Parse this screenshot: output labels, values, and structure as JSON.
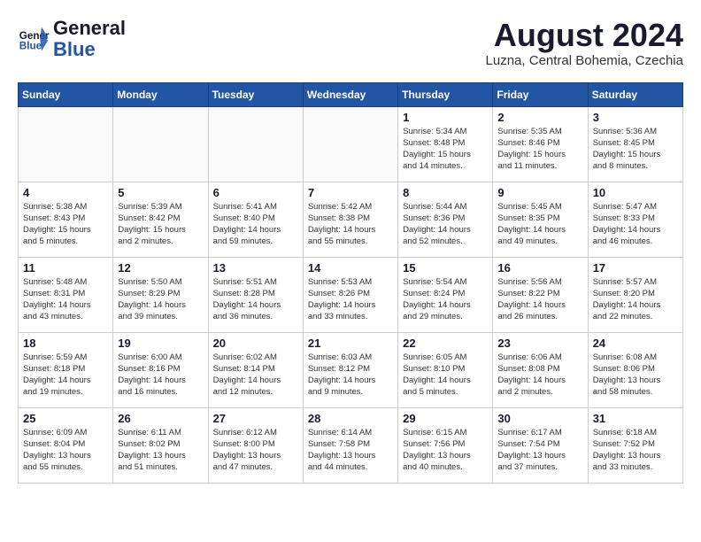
{
  "header": {
    "logo_general": "General",
    "logo_blue": "Blue",
    "month_year": "August 2024",
    "location": "Luzna, Central Bohemia, Czechia"
  },
  "weekdays": [
    "Sunday",
    "Monday",
    "Tuesday",
    "Wednesday",
    "Thursday",
    "Friday",
    "Saturday"
  ],
  "weeks": [
    [
      {
        "day": "",
        "info": ""
      },
      {
        "day": "",
        "info": ""
      },
      {
        "day": "",
        "info": ""
      },
      {
        "day": "",
        "info": ""
      },
      {
        "day": "1",
        "info": "Sunrise: 5:34 AM\nSunset: 8:48 PM\nDaylight: 15 hours\nand 14 minutes."
      },
      {
        "day": "2",
        "info": "Sunrise: 5:35 AM\nSunset: 8:46 PM\nDaylight: 15 hours\nand 11 minutes."
      },
      {
        "day": "3",
        "info": "Sunrise: 5:36 AM\nSunset: 8:45 PM\nDaylight: 15 hours\nand 8 minutes."
      }
    ],
    [
      {
        "day": "4",
        "info": "Sunrise: 5:38 AM\nSunset: 8:43 PM\nDaylight: 15 hours\nand 5 minutes."
      },
      {
        "day": "5",
        "info": "Sunrise: 5:39 AM\nSunset: 8:42 PM\nDaylight: 15 hours\nand 2 minutes."
      },
      {
        "day": "6",
        "info": "Sunrise: 5:41 AM\nSunset: 8:40 PM\nDaylight: 14 hours\nand 59 minutes."
      },
      {
        "day": "7",
        "info": "Sunrise: 5:42 AM\nSunset: 8:38 PM\nDaylight: 14 hours\nand 55 minutes."
      },
      {
        "day": "8",
        "info": "Sunrise: 5:44 AM\nSunset: 8:36 PM\nDaylight: 14 hours\nand 52 minutes."
      },
      {
        "day": "9",
        "info": "Sunrise: 5:45 AM\nSunset: 8:35 PM\nDaylight: 14 hours\nand 49 minutes."
      },
      {
        "day": "10",
        "info": "Sunrise: 5:47 AM\nSunset: 8:33 PM\nDaylight: 14 hours\nand 46 minutes."
      }
    ],
    [
      {
        "day": "11",
        "info": "Sunrise: 5:48 AM\nSunset: 8:31 PM\nDaylight: 14 hours\nand 43 minutes."
      },
      {
        "day": "12",
        "info": "Sunrise: 5:50 AM\nSunset: 8:29 PM\nDaylight: 14 hours\nand 39 minutes."
      },
      {
        "day": "13",
        "info": "Sunrise: 5:51 AM\nSunset: 8:28 PM\nDaylight: 14 hours\nand 36 minutes."
      },
      {
        "day": "14",
        "info": "Sunrise: 5:53 AM\nSunset: 8:26 PM\nDaylight: 14 hours\nand 33 minutes."
      },
      {
        "day": "15",
        "info": "Sunrise: 5:54 AM\nSunset: 8:24 PM\nDaylight: 14 hours\nand 29 minutes."
      },
      {
        "day": "16",
        "info": "Sunrise: 5:56 AM\nSunset: 8:22 PM\nDaylight: 14 hours\nand 26 minutes."
      },
      {
        "day": "17",
        "info": "Sunrise: 5:57 AM\nSunset: 8:20 PM\nDaylight: 14 hours\nand 22 minutes."
      }
    ],
    [
      {
        "day": "18",
        "info": "Sunrise: 5:59 AM\nSunset: 8:18 PM\nDaylight: 14 hours\nand 19 minutes."
      },
      {
        "day": "19",
        "info": "Sunrise: 6:00 AM\nSunset: 8:16 PM\nDaylight: 14 hours\nand 16 minutes."
      },
      {
        "day": "20",
        "info": "Sunrise: 6:02 AM\nSunset: 8:14 PM\nDaylight: 14 hours\nand 12 minutes."
      },
      {
        "day": "21",
        "info": "Sunrise: 6:03 AM\nSunset: 8:12 PM\nDaylight: 14 hours\nand 9 minutes."
      },
      {
        "day": "22",
        "info": "Sunrise: 6:05 AM\nSunset: 8:10 PM\nDaylight: 14 hours\nand 5 minutes."
      },
      {
        "day": "23",
        "info": "Sunrise: 6:06 AM\nSunset: 8:08 PM\nDaylight: 14 hours\nand 2 minutes."
      },
      {
        "day": "24",
        "info": "Sunrise: 6:08 AM\nSunset: 8:06 PM\nDaylight: 13 hours\nand 58 minutes."
      }
    ],
    [
      {
        "day": "25",
        "info": "Sunrise: 6:09 AM\nSunset: 8:04 PM\nDaylight: 13 hours\nand 55 minutes."
      },
      {
        "day": "26",
        "info": "Sunrise: 6:11 AM\nSunset: 8:02 PM\nDaylight: 13 hours\nand 51 minutes."
      },
      {
        "day": "27",
        "info": "Sunrise: 6:12 AM\nSunset: 8:00 PM\nDaylight: 13 hours\nand 47 minutes."
      },
      {
        "day": "28",
        "info": "Sunrise: 6:14 AM\nSunset: 7:58 PM\nDaylight: 13 hours\nand 44 minutes."
      },
      {
        "day": "29",
        "info": "Sunrise: 6:15 AM\nSunset: 7:56 PM\nDaylight: 13 hours\nand 40 minutes."
      },
      {
        "day": "30",
        "info": "Sunrise: 6:17 AM\nSunset: 7:54 PM\nDaylight: 13 hours\nand 37 minutes."
      },
      {
        "day": "31",
        "info": "Sunrise: 6:18 AM\nSunset: 7:52 PM\nDaylight: 13 hours\nand 33 minutes."
      }
    ]
  ]
}
